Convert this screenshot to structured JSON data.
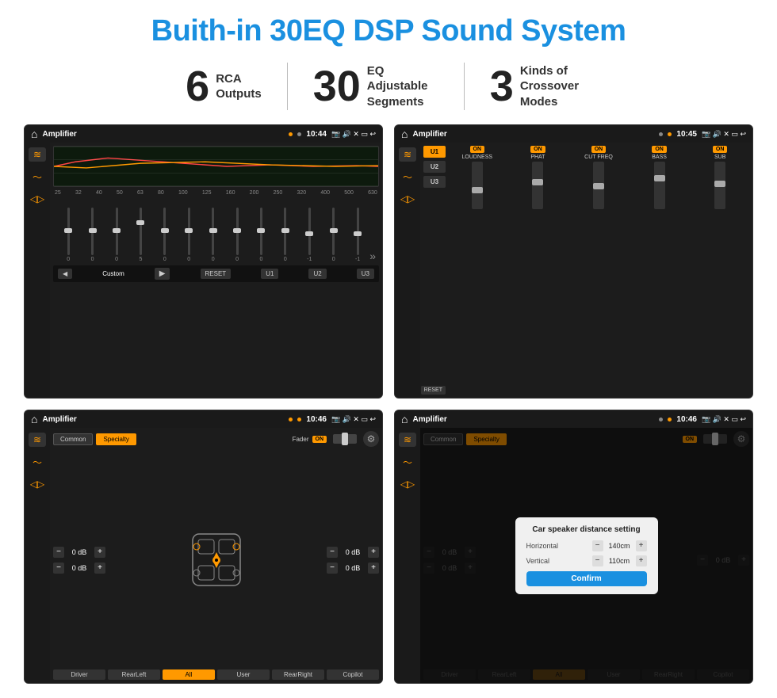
{
  "title": "Buith-in 30EQ DSP Sound System",
  "stats": [
    {
      "number": "6",
      "label": "RCA\nOutputs"
    },
    {
      "number": "30",
      "label": "EQ Adjustable\nSegments"
    },
    {
      "number": "3",
      "label": "Kinds of\nCrossover Modes"
    }
  ],
  "screens": [
    {
      "id": "screen1",
      "status": {
        "title": "Amplifier",
        "time": "10:44"
      },
      "type": "eq",
      "freqs": [
        "25",
        "32",
        "40",
        "50",
        "63",
        "80",
        "100",
        "125",
        "160",
        "200",
        "250",
        "320",
        "400",
        "500",
        "630"
      ],
      "values": [
        "0",
        "0",
        "0",
        "5",
        "0",
        "0",
        "0",
        "0",
        "0",
        "0",
        "-1",
        "0",
        "-1"
      ],
      "presets": [
        "Custom",
        "RESET",
        "U1",
        "U2",
        "U3"
      ]
    },
    {
      "id": "screen2",
      "status": {
        "title": "Amplifier",
        "time": "10:45"
      },
      "type": "amp2",
      "presets": [
        "U1",
        "U2",
        "U3"
      ],
      "channels": [
        "LOUDNESS",
        "PHAT",
        "CUT FREQ",
        "BASS",
        "SUB"
      ]
    },
    {
      "id": "screen3",
      "status": {
        "title": "Amplifier",
        "time": "10:46"
      },
      "type": "fader",
      "tabs": [
        "Common",
        "Specialty"
      ],
      "faderLabel": "Fader",
      "volumes": [
        "0 dB",
        "0 dB",
        "0 dB",
        "0 dB"
      ],
      "buttons": [
        "Driver",
        "RearLeft",
        "All",
        "User",
        "RearRight",
        "Copilot"
      ]
    },
    {
      "id": "screen4",
      "status": {
        "title": "Amplifier",
        "time": "10:46"
      },
      "type": "dialog",
      "tabs": [
        "Common",
        "Specialty"
      ],
      "dialog": {
        "title": "Car speaker distance setting",
        "horizontal_label": "Horizontal",
        "horizontal_value": "140cm",
        "vertical_label": "Vertical",
        "vertical_value": "110cm",
        "confirm_label": "Confirm"
      },
      "volumes": [
        "0 dB",
        "0 dB"
      ],
      "buttons": [
        "Driver",
        "RearLeft",
        "All",
        "User",
        "RearRight",
        "Copilot"
      ]
    }
  ],
  "icons": {
    "home": "⌂",
    "pin": "📍",
    "speaker": "🔊",
    "back": "↩",
    "settings": "⚙"
  }
}
